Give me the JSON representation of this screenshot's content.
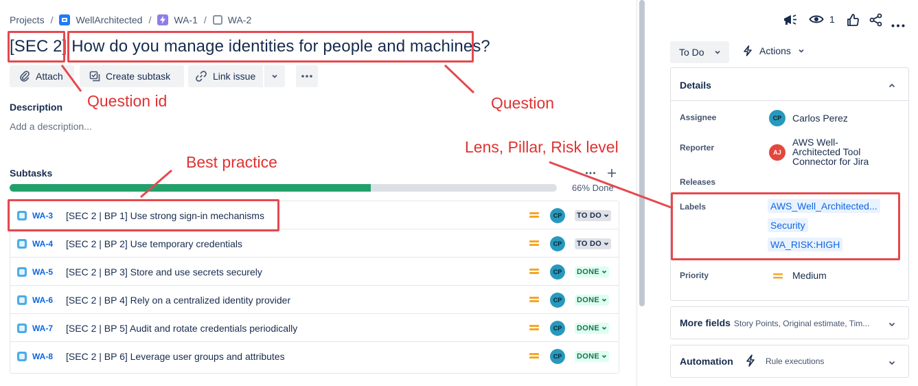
{
  "breadcrumb": {
    "items": [
      "Projects",
      "WellArchitected",
      "WA-1",
      "WA-2"
    ],
    "separator": "/"
  },
  "issue": {
    "question_id": "[SEC 2]",
    "question": "How do you manage identities for people and machines?"
  },
  "toolbar": {
    "attach_label": "Attach",
    "create_subtask_label": "Create subtask",
    "link_issue_label": "Link issue"
  },
  "description": {
    "heading": "Description",
    "placeholder": "Add a description..."
  },
  "subtasks": {
    "heading": "Subtasks",
    "progress_percent": 66,
    "progress_label": "66% Done",
    "items": [
      {
        "key": "WA-3",
        "summary": "[SEC 2 | BP 1] Use strong sign-in mechanisms",
        "assignee": "CP",
        "status": "TO DO"
      },
      {
        "key": "WA-4",
        "summary": "[SEC 2 | BP 2] Use temporary credentials",
        "assignee": "CP",
        "status": "TO DO"
      },
      {
        "key": "WA-5",
        "summary": "[SEC 2 | BP 3] Store and use secrets securely",
        "assignee": "CP",
        "status": "DONE"
      },
      {
        "key": "WA-6",
        "summary": "[SEC 2 | BP 4] Rely on a centralized identity provider",
        "assignee": "CP",
        "status": "DONE"
      },
      {
        "key": "WA-7",
        "summary": "[SEC 2 | BP 5] Audit and rotate credentials periodically",
        "assignee": "CP",
        "status": "DONE"
      },
      {
        "key": "WA-8",
        "summary": "[SEC 2 | BP 6] Leverage user groups and attributes",
        "assignee": "CP",
        "status": "DONE"
      }
    ]
  },
  "topbar": {
    "watch_count": "1"
  },
  "status_button": "To Do",
  "actions_button": "Actions",
  "details": {
    "heading": "Details",
    "assignee_label": "Assignee",
    "assignee_initials": "CP",
    "assignee_name": "Carlos Perez",
    "reporter_label": "Reporter",
    "reporter_initials": "AJ",
    "reporter_name_lines": [
      "AWS Well-",
      "Architected Tool",
      "Connector for Jira"
    ],
    "releases_label": "Releases",
    "labels_label": "Labels",
    "labels": [
      "AWS_Well_Architected...",
      "Security",
      "WA_RISK:HIGH"
    ],
    "priority_label": "Priority",
    "priority_value": "Medium"
  },
  "more_fields": {
    "heading": "More fields",
    "hint": "Story Points, Original estimate, Tim..."
  },
  "automation": {
    "heading": "Automation",
    "hint": "Rule executions"
  },
  "annotations": {
    "question_id": "Question id",
    "question": "Question",
    "best_practice": "Best practice",
    "lens_pillar_risk": "Lens, Pillar, Risk level"
  },
  "colors": {
    "annotation": "#e5484d",
    "link": "#0c66e4",
    "progress": "#22a06b",
    "avatar": "#2898bd",
    "reporter_avatar": "#e2483d",
    "priority_medium": "#f5a623"
  }
}
